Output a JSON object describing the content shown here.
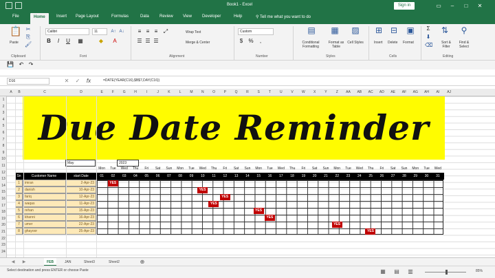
{
  "window": {
    "title": "Book1 - Excel",
    "sign_in": "Sign in"
  },
  "tabs": [
    "File",
    "Home",
    "Insert",
    "Page Layout",
    "Formulas",
    "Data",
    "Review",
    "View",
    "Developer",
    "Help"
  ],
  "tell_me": "Tell me what you want to do",
  "ribbon": {
    "paste": "Paste",
    "font_name": "Calibri",
    "font_size": "11",
    "wrap_text": "Wrap Text",
    "merge_center": "Merge & Center",
    "number_format": "Custom",
    "conditional_formatting": "Conditional Formatting",
    "format_as_table": "Format as Table",
    "cell_styles": "Cell Styles",
    "insert": "Insert",
    "delete": "Delete",
    "format": "Format",
    "sort_filter": "Sort & Filter",
    "find_select": "Find & Select",
    "groups": [
      "Clipboard",
      "Font",
      "Alignment",
      "Number",
      "Styles",
      "Cells",
      "Editing"
    ]
  },
  "formula_bar": {
    "name_box": "D16",
    "formula": "=DATE(YEAR(C16),$B$7,DAY(C16))"
  },
  "columns": [
    "A",
    "B",
    "C",
    "D",
    "E",
    "F",
    "G",
    "H",
    "I",
    "J",
    "K",
    "L",
    "M",
    "N",
    "O",
    "P",
    "Q",
    "R",
    "S",
    "T",
    "U",
    "V",
    "W",
    "X",
    "Y",
    "Z",
    "AA",
    "AB",
    "AC",
    "AD",
    "AE",
    "AF",
    "AG",
    "AH",
    "AI",
    "AJ"
  ],
  "rows": [
    "1",
    "2",
    "3",
    "4",
    "5",
    "6",
    "7",
    "8",
    "9",
    "10",
    "11",
    "12",
    "13",
    "14",
    "15",
    "16",
    "17",
    "18",
    "19",
    "20",
    "21",
    "22",
    "23",
    "24"
  ],
  "banner_title": "Due Date Reminder",
  "month_cell": "May",
  "year_cell": "2023",
  "weekdays": [
    "Mon",
    "Tue",
    "Wed",
    "Thu",
    "Fri",
    "Sat",
    "Sun",
    "Mon",
    "Tue",
    "Wed",
    "Thu",
    "Fri",
    "Sat",
    "Sun",
    "Mon",
    "Tue",
    "Wed",
    "Thu",
    "Fri",
    "Sat",
    "Sun",
    "Mon",
    "Tue",
    "Wed",
    "Thu",
    "Fri",
    "Sat",
    "Sun",
    "Mon",
    "Tue",
    "Wed"
  ],
  "table": {
    "headers": {
      "sn": "Sn",
      "customer": "Customer Name",
      "start": "start Date"
    },
    "days": [
      "01",
      "02",
      "03",
      "04",
      "05",
      "06",
      "07",
      "08",
      "09",
      "10",
      "11",
      "12",
      "13",
      "14",
      "15",
      "16",
      "17",
      "18",
      "19",
      "20",
      "21",
      "22",
      "23",
      "24",
      "25",
      "26",
      "27",
      "28",
      "29",
      "30",
      "31"
    ],
    "rows": [
      {
        "sn": "1",
        "name": "imran",
        "date": "2-Apr-23",
        "due_day": 2
      },
      {
        "sn": "2",
        "name": "danish",
        "date": "10-Apr-23",
        "due_day": 10
      },
      {
        "sn": "3",
        "name": "fariq",
        "date": "12-Apr-23",
        "due_day": 12
      },
      {
        "sn": "4",
        "name": "waqas",
        "date": "11-Apr-23",
        "due_day": 11
      },
      {
        "sn": "5",
        "name": "rehan",
        "date": "15-Apr-23",
        "due_day": 15
      },
      {
        "sn": "6",
        "name": "khanni",
        "date": "16-Apr-23",
        "due_day": 16
      },
      {
        "sn": "7",
        "name": "umer",
        "date": "22-Apr-23",
        "due_day": 22
      },
      {
        "sn": "8",
        "name": "ghayoor",
        "date": "25-Apr-23",
        "due_day": 25
      }
    ],
    "flag_text": "YES"
  },
  "sheet_tabs": [
    "FEB",
    "JAN",
    "Sheet3",
    "Sheet2"
  ],
  "status": {
    "message": "Select destination and press ENTER or choose Paste",
    "zoom": "85%"
  }
}
